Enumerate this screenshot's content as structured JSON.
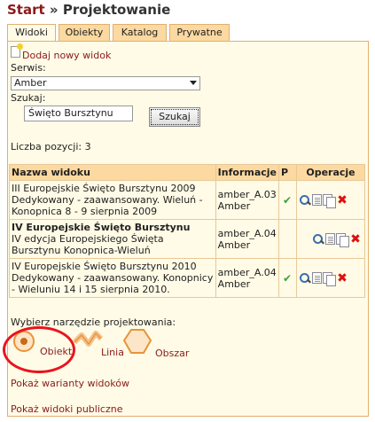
{
  "breadcrumb": {
    "start": "Start",
    "separator": "»",
    "current": "Projektowanie"
  },
  "tabs": [
    {
      "label": "Widoki",
      "active": true
    },
    {
      "label": "Obiekty",
      "active": false
    },
    {
      "label": "Katalog",
      "active": false
    },
    {
      "label": "Prywatne",
      "active": false
    }
  ],
  "add_view": "Dodaj nowy widok",
  "service": {
    "label": "Serwis:",
    "selected": "Amber"
  },
  "search": {
    "label": "Szukaj:",
    "value": "Święto Bursztynu",
    "button": "Szukaj"
  },
  "count_text": "Liczba pozycji: 3",
  "table": {
    "headers": [
      "Nazwa widoku",
      "Informacje",
      "P",
      "Operacje"
    ],
    "rows": [
      {
        "title": "",
        "desc": "III Europejskie Święto Bursztynu 2009 Dedykowany - zaawansowany. Wieluń - Konopnica 8 - 9 sierpnia 2009",
        "info1": "amber_A.03",
        "info2": "Amber",
        "published": true
      },
      {
        "title": "IV Europejskie Święto Bursztynu",
        "desc": "IV edycja Europejskiego Święta Bursztynu Konopnica-Wieluń",
        "info1": "amber_A.04",
        "info2": "Amber",
        "published": false
      },
      {
        "title": "",
        "desc": "IV Europejskie Święto Bursztynu 2010 Dedykowany - zaawansowany. Konopnicy - Wieluniu 14 i 15 sierpnia 2010.",
        "info1": "amber_A.04",
        "info2": "Amber",
        "published": true
      }
    ]
  },
  "tool_label": "Wybierz narzędzie projektowania:",
  "tools": {
    "obiekt": "Obiekt",
    "linia": "Linia",
    "obszar": "Obszar"
  },
  "links": {
    "variants": "Pokaż warianty widoków",
    "public": "Pokaż widoki publiczne"
  },
  "colors": {
    "accent": "#8b1a1a",
    "tab_bg": "#fcd9a0",
    "panel_bg": "#fffbe6",
    "highlight": "#e8141e"
  }
}
